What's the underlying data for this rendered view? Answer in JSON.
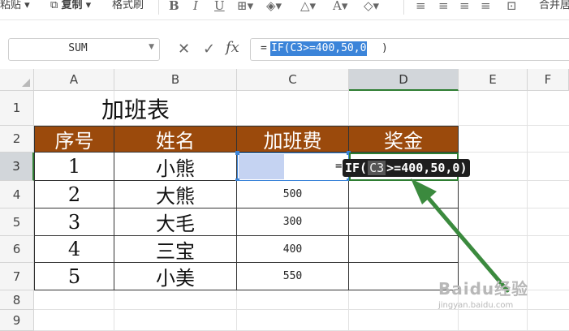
{
  "toolbar": {
    "paste_label": "粘贴",
    "copy_label": "复制",
    "format_painter_label": "格式刷",
    "merge_label": "合并居"
  },
  "name_box": {
    "value": "SUM"
  },
  "formula_bar": {
    "fx_label": "fx",
    "eq": "=",
    "selected": "IF(C3>=400,50,0",
    "close": ")"
  },
  "columns": [
    "A",
    "B",
    "C",
    "D",
    "E",
    "F"
  ],
  "rows": [
    "1",
    "2",
    "3",
    "4",
    "5",
    "6",
    "7",
    "8",
    "9"
  ],
  "sheet": {
    "title": "加班表",
    "headers": [
      "序号",
      "姓名",
      "加班费",
      "奖金"
    ],
    "records": [
      {
        "no": "1",
        "name": "小熊",
        "overtime": ""
      },
      {
        "no": "2",
        "name": "大熊",
        "overtime": "500"
      },
      {
        "no": "3",
        "name": "大毛",
        "overtime": "300"
      },
      {
        "no": "4",
        "name": "三宝",
        "overtime": "400"
      },
      {
        "no": "5",
        "name": "小美",
        "overtime": "550"
      }
    ]
  },
  "editing": {
    "eq": "=",
    "fn": "IF(",
    "arg": "C3",
    "rest": ">=400,50,0",
    "close": ")"
  },
  "watermark": {
    "brand": "Baidu经验",
    "url": "jingyan.baidu.com"
  },
  "colors": {
    "header_fill": "#9b4a0c",
    "selection": "#3b84d9",
    "arrow": "#3b8a3e"
  }
}
